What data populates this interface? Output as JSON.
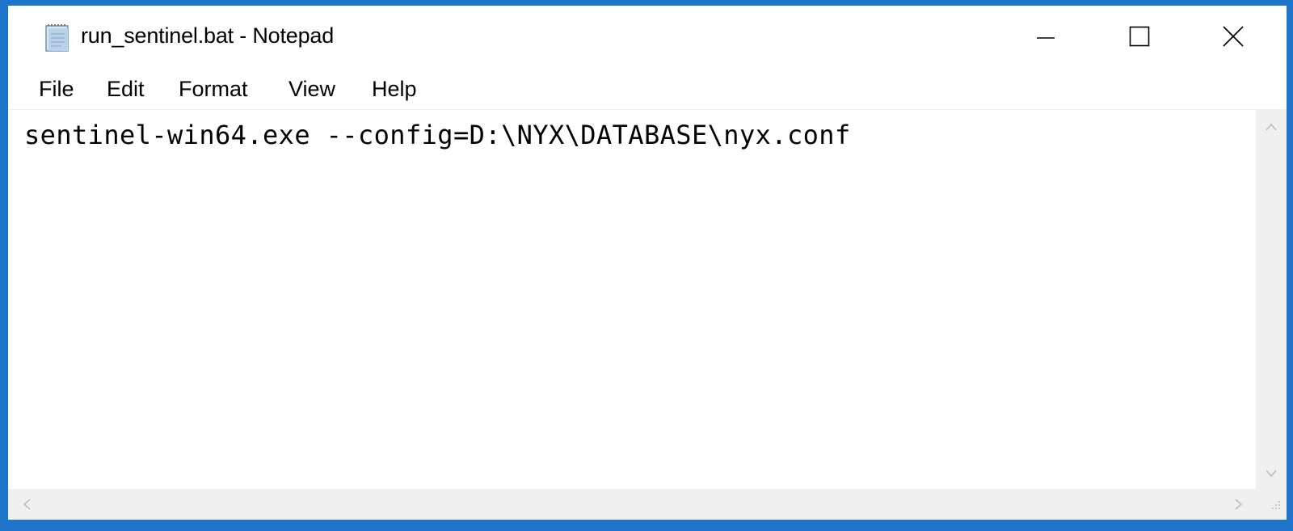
{
  "window": {
    "title": "run_sentinel.bat - Notepad",
    "icon": "notepad-icon"
  },
  "controls": {
    "minimize_icon": "minimize-icon",
    "maximize_icon": "maximize-icon",
    "close_icon": "close-icon"
  },
  "menu": {
    "items": [
      {
        "label": "File"
      },
      {
        "label": "Edit"
      },
      {
        "label": "Format"
      },
      {
        "label": "View"
      },
      {
        "label": "Help"
      }
    ]
  },
  "editor": {
    "content": "sentinel-win64.exe --config=D:\\NYX\\DATABASE\\nyx.conf"
  },
  "colors": {
    "frame": "#1e74c8",
    "scrollbar": "#f0f0f0"
  }
}
